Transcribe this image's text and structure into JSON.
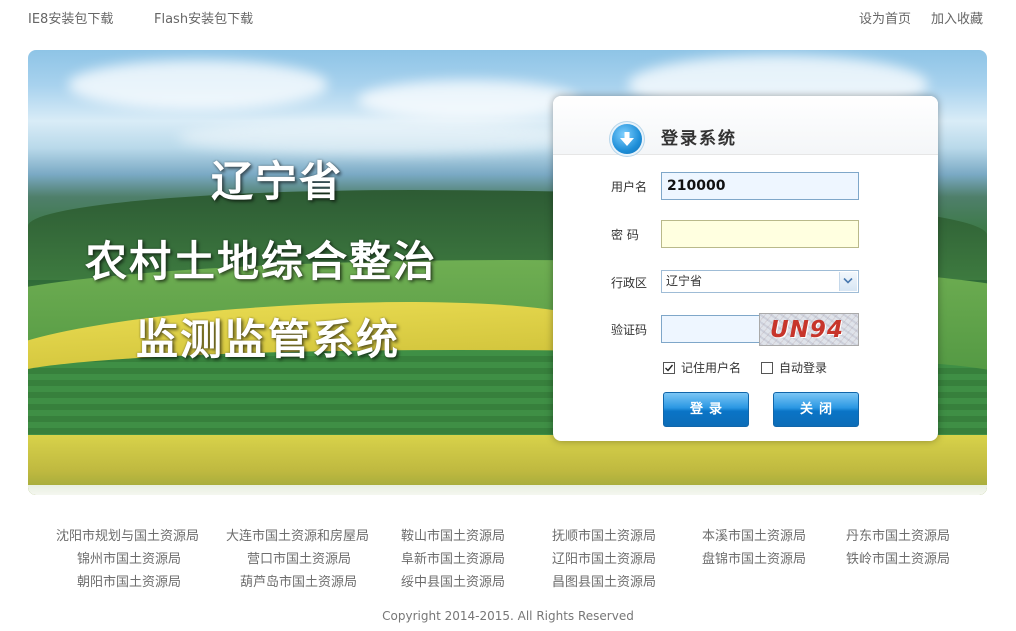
{
  "top": {
    "ie8_download": "IE8安装包下载",
    "flash_download": "Flash安装包下载",
    "set_homepage": "设为首页",
    "add_favorite": "加入收藏"
  },
  "banner": {
    "line1": "辽宁省",
    "line2": "农村土地综合整治",
    "line3": "监测监管系统"
  },
  "login": {
    "title": "登录系统",
    "username_label": "用户名",
    "username_value": "210000",
    "password_label": "密 码",
    "region_label": "行政区",
    "region_value": "辽宁省",
    "captcha_label": "验证码",
    "captcha_text": "UN94",
    "remember_label": "记住用户名",
    "remember_checked": true,
    "autologin_label": "自动登录",
    "autologin_checked": false,
    "login_button": "登录",
    "close_button": "关闭"
  },
  "links": [
    "沈阳市规划与国土资源局",
    "大连市国土资源和房屋局",
    "鞍山市国土资源局",
    "抚顺市国土资源局",
    "本溪市国土资源局",
    "丹东市国土资源局",
    "锦州市国土资源局",
    "营口市国土资源局",
    "阜新市国土资源局",
    "辽阳市国土资源局",
    "盘锦市国土资源局",
    "铁岭市国土资源局",
    "朝阳市国土资源局",
    "葫芦岛市国土资源局",
    "绥中县国土资源局",
    "昌图县国土资源局"
  ],
  "copyright": "Copyright 2014-2015. All Rights Reserved",
  "colors": {
    "accent": "#1f8fd8",
    "button": "#0a74c6",
    "captcha": "#c7352b"
  }
}
